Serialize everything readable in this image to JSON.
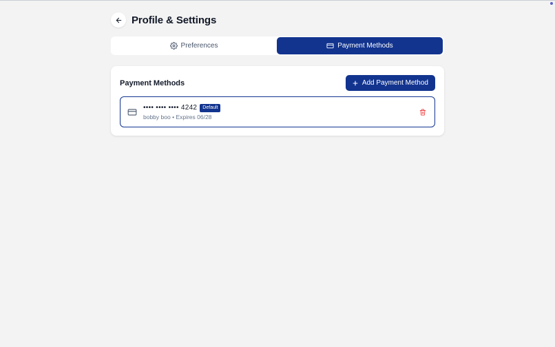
{
  "header": {
    "title": "Profile & Settings",
    "back_icon": "arrow-left-icon"
  },
  "tabs": [
    {
      "label": "Preferences",
      "icon": "gear-icon",
      "active": false
    },
    {
      "label": "Payment Methods",
      "icon": "credit-card-icon",
      "active": true
    }
  ],
  "payment_card": {
    "title": "Payment Methods",
    "add_button_label": "Add Payment Method",
    "add_icon": "plus-icon"
  },
  "methods": [
    {
      "number": "•••• •••• •••• 4242",
      "badge": "Default",
      "holder": "bobby boo",
      "separator": "•",
      "expires": "Expires 06/28",
      "icon": "credit-card-icon",
      "delete_icon": "trash-icon"
    }
  ],
  "colors": {
    "primary": "#12348f",
    "background": "#f3f3f3",
    "card": "#ffffff",
    "danger": "#ef4444",
    "muted_text": "#64748b"
  }
}
